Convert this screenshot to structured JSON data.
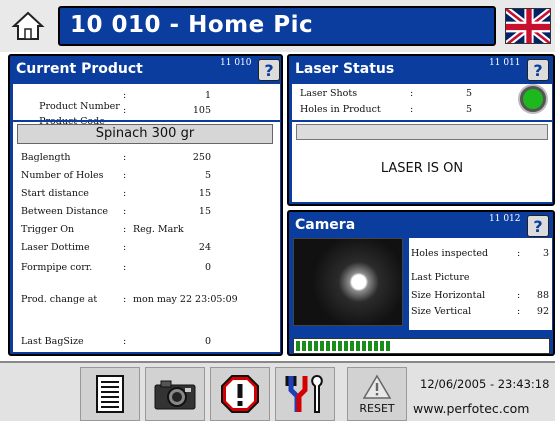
{
  "header": {
    "title": "10 010 - Home Pic",
    "home_icon": "home-icon",
    "flag_icon": "uk-flag-icon"
  },
  "current_product": {
    "title": "Current Product",
    "code": "11 010",
    "help": "?",
    "top_fields": [
      {
        "label": "Product Number",
        "sep": ":",
        "value": "1"
      },
      {
        "label": "Product Code",
        "sep": ":",
        "value": "105"
      }
    ],
    "product_name": "Spinach 300 gr",
    "fields": [
      {
        "label": "Baglength",
        "sep": ":",
        "value": "250"
      },
      {
        "label": "Number of Holes",
        "sep": ":",
        "value": "5"
      },
      {
        "label": "Start distance",
        "sep": ":",
        "value": "15"
      },
      {
        "label": "Between Distance",
        "sep": ":",
        "value": "15"
      },
      {
        "label": "Trigger On",
        "sep": ":",
        "value": "Reg. Mark"
      },
      {
        "label": "Laser Dottime",
        "sep": ":",
        "value": "24"
      },
      {
        "label": "Formpipe corr.",
        "sep": ":",
        "value": "0"
      }
    ],
    "prod_change": {
      "label": "Prod. change at",
      "sep": ":",
      "value": "mon may 22 23:05:09"
    },
    "last_bag": {
      "label": "Last BagSize",
      "sep": ":",
      "value": "0"
    }
  },
  "laser_status": {
    "title": "Laser Status",
    "code": "11 011",
    "help": "?",
    "fields": [
      {
        "label": "Laser Shots",
        "sep": ":",
        "value": "5"
      },
      {
        "label": "Holes in Product",
        "sep": ":",
        "value": "5"
      }
    ],
    "status_text": "LASER IS ON",
    "indicator_color": "#1db81d"
  },
  "camera": {
    "title": "Camera",
    "code": "11 012",
    "help": "?",
    "fields": [
      {
        "label": "Holes inspected",
        "sep": ":",
        "value": "3"
      },
      {
        "label": "Last Picture",
        "sep": "",
        "value": ""
      },
      {
        "label": "Size Horizontal",
        "sep": ":",
        "value": "88"
      },
      {
        "label": "Size Vertical",
        "sep": ":",
        "value": "92"
      }
    ],
    "progress_segments": 16,
    "progress_fraction": 0.49
  },
  "toolbar": {
    "buttons": [
      "document-list-icon",
      "camera-icon",
      "alarm-stop-icon",
      "tools-icon",
      "reset-warning-icon"
    ],
    "reset_label": "RESET",
    "datetime": "12/06/2005 - 23:43:18",
    "website": "www.perfotec.com"
  },
  "colors": {
    "panel_blue": "#0a3d9e",
    "progress_green": "#1a8c1a",
    "alarm_red": "#d40000"
  }
}
